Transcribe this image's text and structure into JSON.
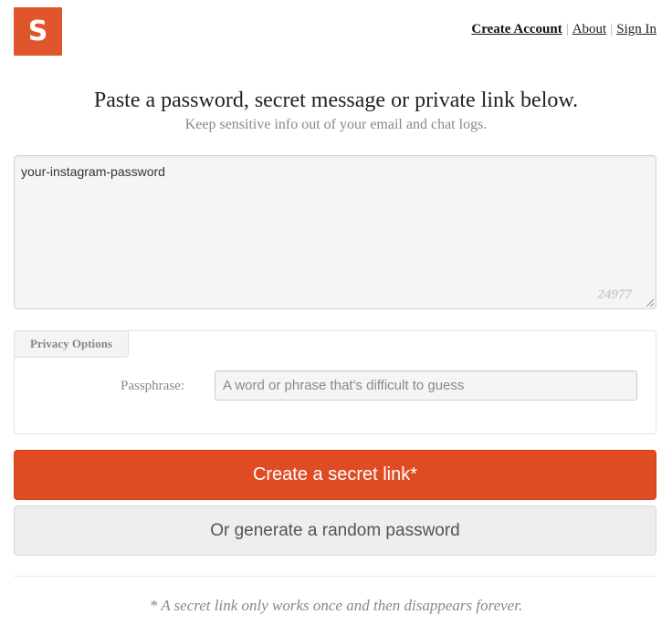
{
  "logo": {
    "letter": "S"
  },
  "nav": {
    "create_account": "Create Account",
    "separator": "|",
    "about": "About",
    "sign_in": "Sign In"
  },
  "headline": "Paste a password, secret message or private link below.",
  "subline": "Keep sensitive info out of your email and chat logs.",
  "secret": {
    "value": "your-instagram-password",
    "char_count": "24977"
  },
  "privacy": {
    "tab_label": "Privacy Options",
    "passphrase_label": "Passphrase:",
    "passphrase_placeholder": "A word or phrase that's difficult to guess"
  },
  "buttons": {
    "create": "Create a secret link*",
    "generate": "Or generate a random password"
  },
  "footnote": "* A secret link only works once and then disappears forever.",
  "colors": {
    "brand": "#df4c24",
    "logo_bg": "#e0562c"
  },
  "icons": {
    "resize": "resize-grip-icon"
  }
}
